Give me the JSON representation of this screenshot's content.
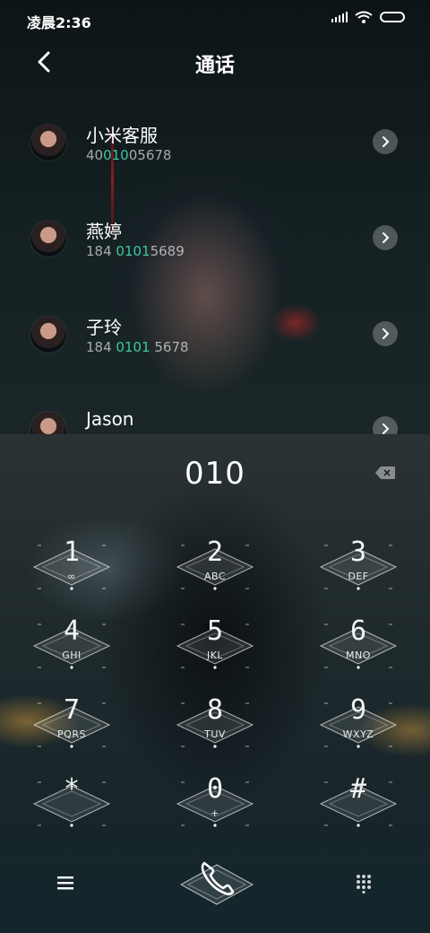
{
  "status_bar": {
    "time": "凌晨2:36"
  },
  "header": {
    "title": "通话"
  },
  "contacts": [
    {
      "name": "小米客服",
      "number_pre": "40",
      "number_hl": "010",
      "number_post": "05678"
    },
    {
      "name": "燕婷",
      "number_pre": "184 ",
      "number_hl": "0101",
      "number_post": "5689"
    },
    {
      "name": "子玲",
      "number_pre": "184 ",
      "number_hl": "0101",
      "number_post": " 5678"
    },
    {
      "name": "Jason",
      "number_pre": "",
      "number_hl": "",
      "number_post": ""
    }
  ],
  "dialer": {
    "entered_number": "010",
    "keys": [
      {
        "digit": "1",
        "letters": "∞"
      },
      {
        "digit": "2",
        "letters": "ABC"
      },
      {
        "digit": "3",
        "letters": "DEF"
      },
      {
        "digit": "4",
        "letters": "GHI"
      },
      {
        "digit": "5",
        "letters": "JKL"
      },
      {
        "digit": "6",
        "letters": "MNO"
      },
      {
        "digit": "7",
        "letters": "PQRS"
      },
      {
        "digit": "8",
        "letters": "TUV"
      },
      {
        "digit": "9",
        "letters": "WXYZ"
      },
      {
        "digit": "*",
        "letters": ""
      },
      {
        "digit": "0",
        "letters": "+"
      },
      {
        "digit": "#",
        "letters": ""
      }
    ]
  },
  "colors": {
    "highlight": "#3ec8a0",
    "background": "#101719"
  },
  "icons": {
    "back": "chevron-left-icon",
    "backspace": "backspace-icon",
    "menu": "menu-icon",
    "call": "phone-icon",
    "keypad": "keypad-grid-icon",
    "contact_action": "chevron-right-icon",
    "signal": "signal-icon",
    "wifi": "wifi-icon",
    "battery": "battery-icon"
  }
}
